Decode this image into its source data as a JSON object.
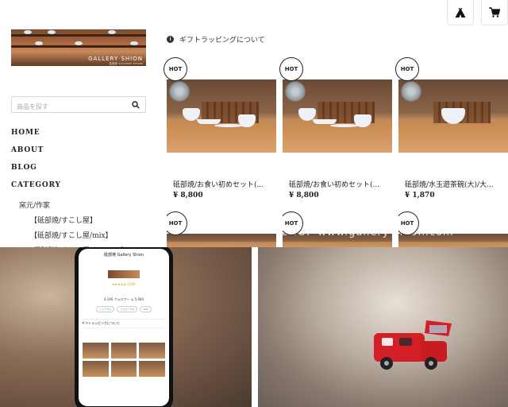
{
  "header": {
    "icons": [
      "tent-icon",
      "cart-icon"
    ]
  },
  "logo": {
    "text": "GALLERY SHION",
    "subtext": "延部焼 GALLERY SHION"
  },
  "search": {
    "placeholder": "商品を探す"
  },
  "nav": {
    "items": [
      "HOME",
      "ABOUT",
      "BLOG",
      "CATEGORY"
    ],
    "sub_heading": "窯元/作家",
    "sub_items": [
      "【砥部焼/すこし屋】",
      "【砥部焼/すこし屋/mix】",
      "【砥部焼/すこし屋/ちゃんこ】"
    ]
  },
  "gift_notice": {
    "text": "ギフトラッピングについて"
  },
  "products": [
    {
      "badge": "HOT",
      "name": "砥部焼/お食い初めセット(...",
      "price": "¥ 8,800"
    },
    {
      "badge": "HOT",
      "name": "砥部焼/お食い初めセット(...",
      "price": "¥ 8,800"
    },
    {
      "badge": "HOT",
      "name": "砥部焼/水玉遊茶碗(大)/大...",
      "price": "¥ 1,870"
    },
    {
      "badge": "HOT"
    },
    {
      "badge": "HOT"
    },
    {
      "badge": "HOT"
    }
  ],
  "watermark": {
    "text": "SHOP www.gallery-shion.com"
  },
  "phone_screen": {
    "title": "砥部焼 Gallery Shion",
    "stats": "4,146 フォロワー   ◎ 5,084",
    "rating": "★★★★★ (229)",
    "buttons": [
      "シェアする",
      "フォローする",
      "SNS"
    ],
    "gift": "ギフトラッピングについて"
  },
  "colors": {
    "text": "#222222",
    "border": "#d8d8d8",
    "toy_car": "#d41f26"
  }
}
